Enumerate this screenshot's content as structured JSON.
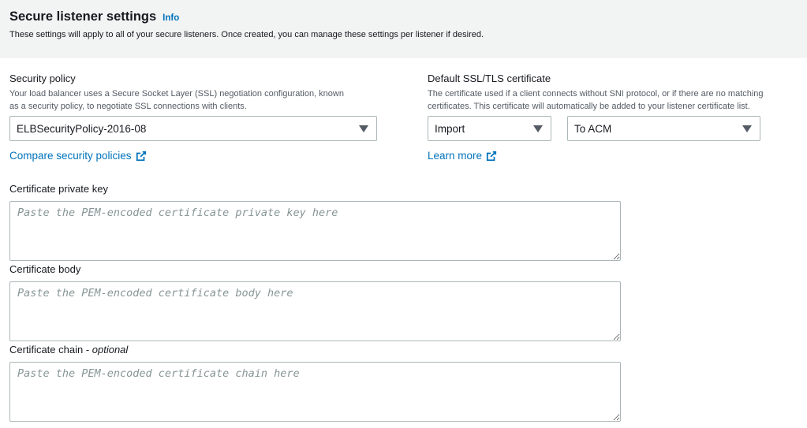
{
  "header": {
    "title": "Secure listener settings",
    "info_label": "Info",
    "description": "These settings will apply to all of your secure listeners. Once created, you can manage these settings per listener if desired."
  },
  "security_policy": {
    "label": "Security policy",
    "description_line1": "Your load balancer uses a Secure Socket Layer (SSL) negotiation configuration, known",
    "description_line2": "as a security policy, to negotiate SSL connections with clients.",
    "selected": "ELBSecurityPolicy-2016-08",
    "compare_link": "Compare security policies"
  },
  "default_certificate": {
    "label": "Default SSL/TLS certificate",
    "description_line1": "The certificate used if a client connects without SNI protocol, or if there are no matching",
    "description_line2": "certificates. This certificate will automatically be added to your listener certificate list.",
    "source_selected": "Import",
    "destination_selected": "To ACM",
    "learn_more_link": "Learn more"
  },
  "certificate_private_key": {
    "label": "Certificate private key",
    "value": "",
    "placeholder": "Paste the PEM-encoded certificate private key here"
  },
  "certificate_body": {
    "label": "Certificate body",
    "value": "",
    "placeholder": "Paste the PEM-encoded certificate body here"
  },
  "certificate_chain": {
    "label": "Certificate chain - ",
    "label_optional": "optional",
    "value": "",
    "placeholder": "Paste the PEM-encoded certificate chain here"
  },
  "colors": {
    "link": "#0073bb",
    "header_bg": "#f2f3f3",
    "border": "#aab7b8",
    "placeholder": "#879596"
  }
}
